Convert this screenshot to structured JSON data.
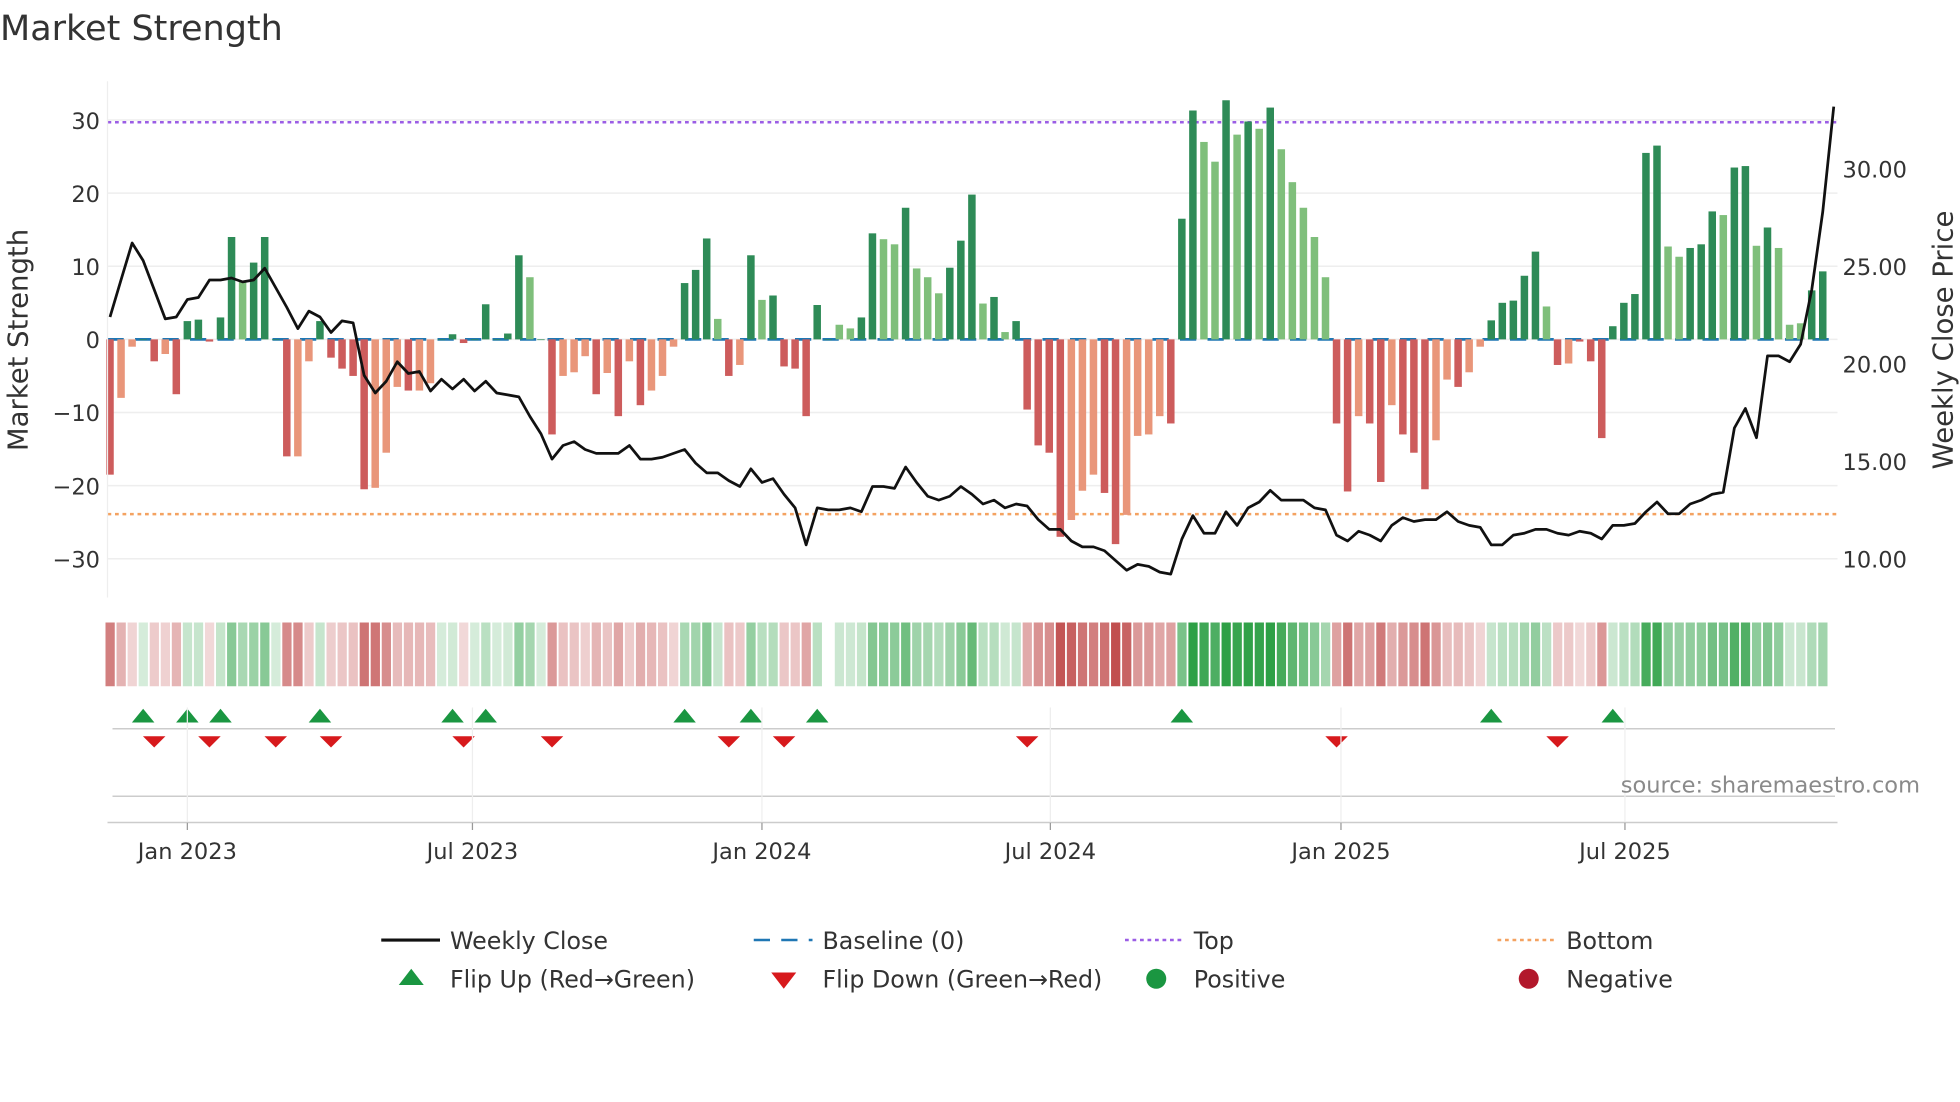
{
  "chart_data": {
    "type": "bar+line",
    "title": "Market Strength",
    "ylabel_left": "Market Strength",
    "ylabel_right": "Weekly Close Price",
    "source": "source: sharemaestro.com",
    "ylim_left": [
      -35.3,
      35.3
    ],
    "ylim_right": [
      8.0,
      34.5
    ],
    "yticks_left": [
      30,
      20,
      10,
      0,
      -10,
      -20,
      -30
    ],
    "yticks_left_labels": [
      "30",
      "20",
      "10",
      "0",
      "−10",
      "−20",
      "−30"
    ],
    "yticks_right": [
      30,
      25,
      20,
      15,
      10
    ],
    "yticks_right_labels": [
      "30.00",
      "25.00",
      "20.00",
      "15.00",
      "10.00"
    ],
    "xticks": [
      {
        "week": 7.0,
        "label": "Jan 2023"
      },
      {
        "week": 32.8,
        "label": "Jul 2023"
      },
      {
        "week": 59.0,
        "label": "Jan 2024"
      },
      {
        "week": 85.1,
        "label": "Jul 2024"
      },
      {
        "week": 111.4,
        "label": "Jan 2025"
      },
      {
        "week": 137.1,
        "label": "Jul 2025"
      }
    ],
    "top_level": 29.7,
    "bottom_level": -23.9,
    "baseline": 0,
    "strength": [
      -18.5,
      -8,
      -1,
      0,
      -3,
      -2,
      -7.5,
      2.5,
      2.7,
      -0.3,
      3,
      14,
      8,
      10.5,
      14,
      0,
      -16,
      -16,
      -3,
      2.5,
      -2.5,
      -4,
      -5,
      -20.5,
      -20.3,
      -15.5,
      -6.5,
      -7,
      -7,
      -6,
      0,
      0.7,
      -0.5,
      0,
      4.8,
      0,
      0.8,
      11.5,
      8.5,
      0,
      -13,
      -5,
      -4.5,
      -2.3,
      -7.5,
      -4.6,
      -10.5,
      -3,
      -9,
      -7,
      -5,
      -1,
      7.7,
      9.5,
      13.8,
      2.8,
      -5,
      -3.5,
      11.5,
      5.4,
      6,
      -3.7,
      -4,
      -10.5,
      4.7,
      0,
      2,
      1.5,
      3,
      14.5,
      13.7,
      13,
      18,
      9.7,
      8.5,
      6.3,
      9.8,
      13.5,
      19.8,
      4.9,
      5.8,
      1,
      2.5,
      -9.6,
      -14.5,
      -15.5,
      -27,
      -24.7,
      -20.7,
      -18.5,
      -21,
      -28,
      -24,
      -13.2,
      -13,
      -10.5,
      -11.5,
      16.5,
      31.3,
      27,
      24.3,
      32.7,
      28,
      29.8,
      28.8,
      31.7,
      26,
      21.5,
      18,
      14,
      8.5,
      -11.5,
      -20.8,
      -10.5,
      -11.5,
      -19.5,
      -9,
      -13,
      -15.5,
      -20.5,
      -13.8,
      -5.5,
      -6.5,
      -4.5,
      -1,
      2.6,
      5,
      5.3,
      8.7,
      12,
      4.5,
      -3.5,
      -3.3,
      -0.3,
      -3,
      -13.5,
      1.8,
      5,
      6.2,
      25.5,
      26.5,
      12.7,
      11.3,
      12.5,
      13,
      17.5,
      17,
      23.5,
      23.7,
      12.8,
      15.3,
      12.5,
      2,
      2.2,
      6.7,
      9.3
    ],
    "strong": [
      1,
      0,
      0,
      1,
      1,
      0,
      1,
      1,
      1,
      1,
      1,
      1,
      0,
      1,
      1,
      1,
      1,
      0,
      0,
      1,
      1,
      1,
      1,
      1,
      0,
      0,
      0,
      1,
      0,
      0,
      1,
      1,
      1,
      1,
      1,
      1,
      1,
      1,
      0,
      1,
      1,
      0,
      0,
      0,
      1,
      0,
      1,
      0,
      1,
      0,
      0,
      0,
      1,
      1,
      1,
      0,
      1,
      0,
      1,
      0,
      1,
      1,
      1,
      1,
      1,
      1,
      0,
      0,
      1,
      1,
      0,
      0,
      1,
      0,
      0,
      0,
      1,
      1,
      1,
      0,
      1,
      0,
      1,
      1,
      1,
      1,
      1,
      0,
      0,
      0,
      1,
      1,
      0,
      0,
      0,
      0,
      1,
      1,
      1,
      0,
      0,
      1,
      0,
      1,
      0,
      1,
      0,
      0,
      0,
      0,
      0,
      1,
      1,
      0,
      1,
      1,
      0,
      1,
      1,
      1,
      0,
      0,
      1,
      0,
      0,
      1,
      1,
      1,
      1,
      1,
      0,
      1,
      0,
      1,
      1,
      1,
      1,
      1,
      1,
      1,
      1,
      0,
      0,
      1,
      1,
      1,
      0,
      1,
      1,
      0,
      1,
      0,
      0,
      0,
      1,
      1
    ],
    "price": [
      22.4,
      24.3,
      26.2,
      25.3,
      23.8,
      22.3,
      22.4,
      23.3,
      23.4,
      24.3,
      24.3,
      24.4,
      24.2,
      24.3,
      24.9,
      23.9,
      22.9,
      21.8,
      22.7,
      22.4,
      21.6,
      22.2,
      22.1,
      19.4,
      18.5,
      19.1,
      20.1,
      19.5,
      19.6,
      18.6,
      19.2,
      18.7,
      19.2,
      18.6,
      19.1,
      18.5,
      18.4,
      18.3,
      17.3,
      16.4,
      15.1,
      15.8,
      16.0,
      15.6,
      15.4,
      15.4,
      15.4,
      15.8,
      15.1,
      15.1,
      15.2,
      15.4,
      15.6,
      14.9,
      14.4,
      14.4,
      14.0,
      13.7,
      14.6,
      13.9,
      14.1,
      13.3,
      12.6,
      10.7,
      12.6,
      12.5,
      12.5,
      12.6,
      12.4,
      13.7,
      13.7,
      13.6,
      14.7,
      13.9,
      13.2,
      13.0,
      13.2,
      13.7,
      13.3,
      12.8,
      13.0,
      12.6,
      12.8,
      12.7,
      12.0,
      11.5,
      11.5,
      10.9,
      10.6,
      10.6,
      10.4,
      9.9,
      9.4,
      9.7,
      9.6,
      9.3,
      9.2,
      11.0,
      12.2,
      11.3,
      11.3,
      12.4,
      11.7,
      12.6,
      12.9,
      13.5,
      13.0,
      13.0,
      13.0,
      12.6,
      12.5,
      11.2,
      10.9,
      11.4,
      11.2,
      10.9,
      11.7,
      12.1,
      11.9,
      12.0,
      12.0,
      12.4,
      11.9,
      11.7,
      11.6,
      10.7,
      10.7,
      11.2,
      11.3,
      11.5,
      11.5,
      11.3,
      11.2,
      11.4,
      11.3,
      11.0,
      11.7,
      11.7,
      11.8,
      12.4,
      12.9,
      12.3,
      12.3,
      12.8,
      13.0,
      13.3,
      13.4,
      16.7,
      17.7,
      16.2,
      20.4,
      20.4,
      20.1,
      21.0,
      23.8,
      27.8,
      33.2
    ],
    "flip_up_weeks": [
      3,
      7,
      10,
      19,
      31,
      34,
      52,
      58,
      64,
      97,
      125,
      136
    ],
    "flip_down_weeks": [
      4,
      9,
      15,
      20,
      32,
      40,
      56,
      61,
      83,
      111,
      131
    ],
    "strip_gap_weeks": [
      65
    ],
    "legend": [
      {
        "label": "Weekly Close",
        "kind": "line",
        "color": "#111111"
      },
      {
        "label": "Baseline (0)",
        "kind": "dash",
        "color": "#1f77b4"
      },
      {
        "label": "Top",
        "kind": "dot",
        "color": "#9b5de5"
      },
      {
        "label": "Bottom",
        "kind": "dot",
        "color": "#f4a261"
      },
      {
        "label": "Flip Up (Red→Green)",
        "kind": "up",
        "color": "#1a9641"
      },
      {
        "label": "Flip Down (Green→Red)",
        "kind": "down",
        "color": "#d7191c"
      },
      {
        "label": "Positive",
        "kind": "circle",
        "color": "#1a9641"
      },
      {
        "label": "Negative",
        "kind": "circle",
        "color": "#b2182b"
      }
    ],
    "colors": {
      "pos_strong": "#2e8b57",
      "pos_weak": "#7fbf7b",
      "neg_strong": "#cd5c5c",
      "neg_weak": "#e9967a"
    }
  }
}
